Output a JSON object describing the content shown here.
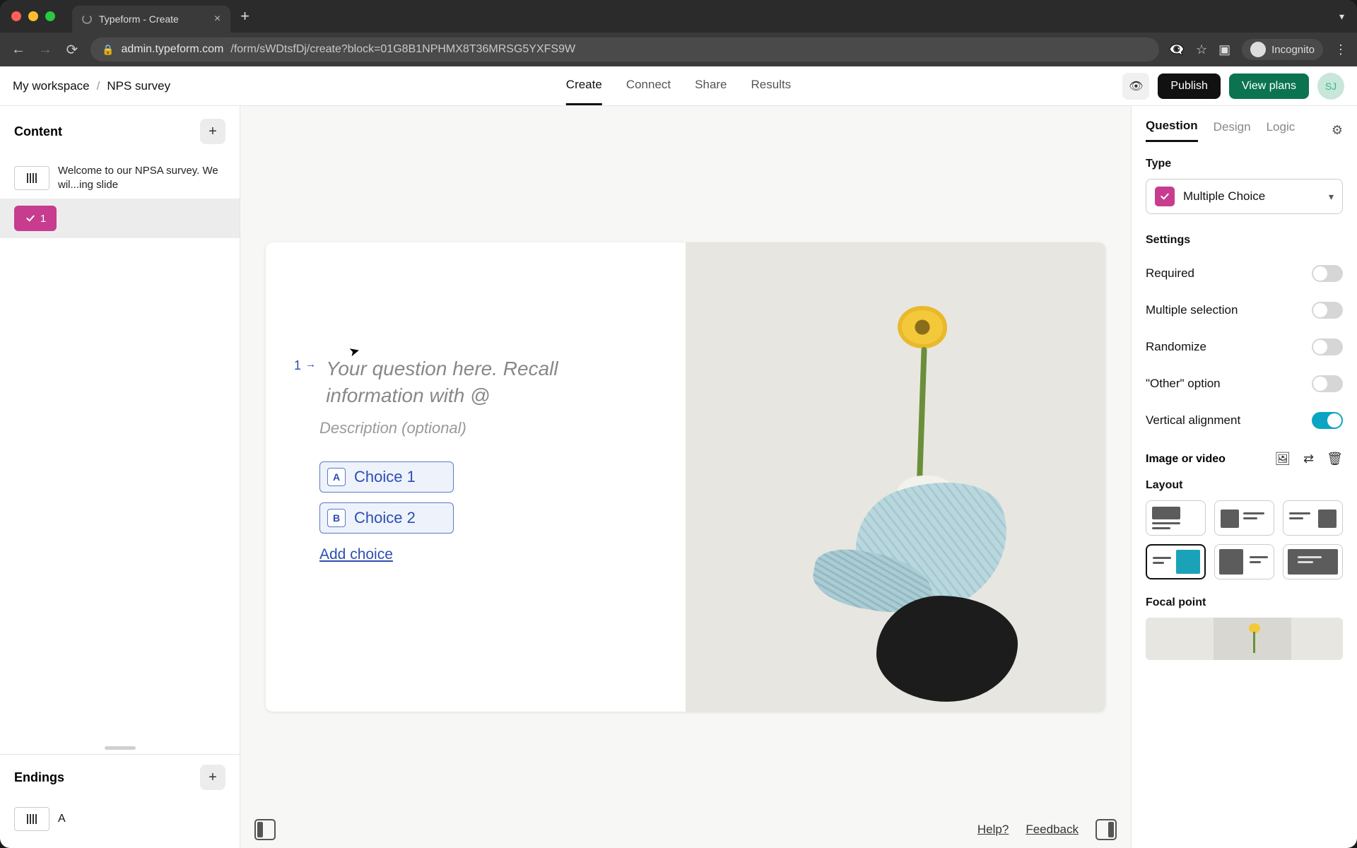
{
  "browser": {
    "tab_title": "Typeform - Create",
    "url_host": "admin.typeform.com",
    "url_path": "/form/sWDtsfDj/create?block=01G8B1NPHMX8T36MRSG5YXFS9W",
    "incognito_label": "Incognito"
  },
  "breadcrumb": {
    "workspace": "My workspace",
    "form": "NPS survey"
  },
  "top_tabs": [
    "Create",
    "Connect",
    "Share",
    "Results"
  ],
  "top_tabs_active": "Create",
  "buttons": {
    "publish": "Publish",
    "view_plans": "View plans"
  },
  "avatar_initials": "SJ",
  "left": {
    "content_title": "Content",
    "slides": [
      {
        "text": "Welcome to our NPSA survey. We wil...ing slide"
      },
      {
        "badge_number": "1"
      }
    ],
    "endings_title": "Endings",
    "ending_letter": "A"
  },
  "canvas": {
    "question_number": "1",
    "question_placeholder": "Your question here. Recall information with @",
    "description_placeholder": "Description (optional)",
    "choices": [
      {
        "key": "A",
        "label": "Choice 1"
      },
      {
        "key": "B",
        "label": "Choice 2"
      }
    ],
    "add_choice": "Add choice"
  },
  "bottom": {
    "help": "Help?",
    "feedback": "Feedback"
  },
  "right": {
    "tabs": [
      "Question",
      "Design",
      "Logic"
    ],
    "tabs_active": "Question",
    "type_label": "Type",
    "type_value": "Multiple Choice",
    "settings_label": "Settings",
    "settings": [
      {
        "label": "Required",
        "on": false
      },
      {
        "label": "Multiple selection",
        "on": false
      },
      {
        "label": "Randomize",
        "on": false
      },
      {
        "label": "\"Other\" option",
        "on": false
      },
      {
        "label": "Vertical alignment",
        "on": true
      }
    ],
    "media_label": "Image or video",
    "layout_label": "Layout",
    "layout_selected_index": 3,
    "focal_label": "Focal point"
  }
}
